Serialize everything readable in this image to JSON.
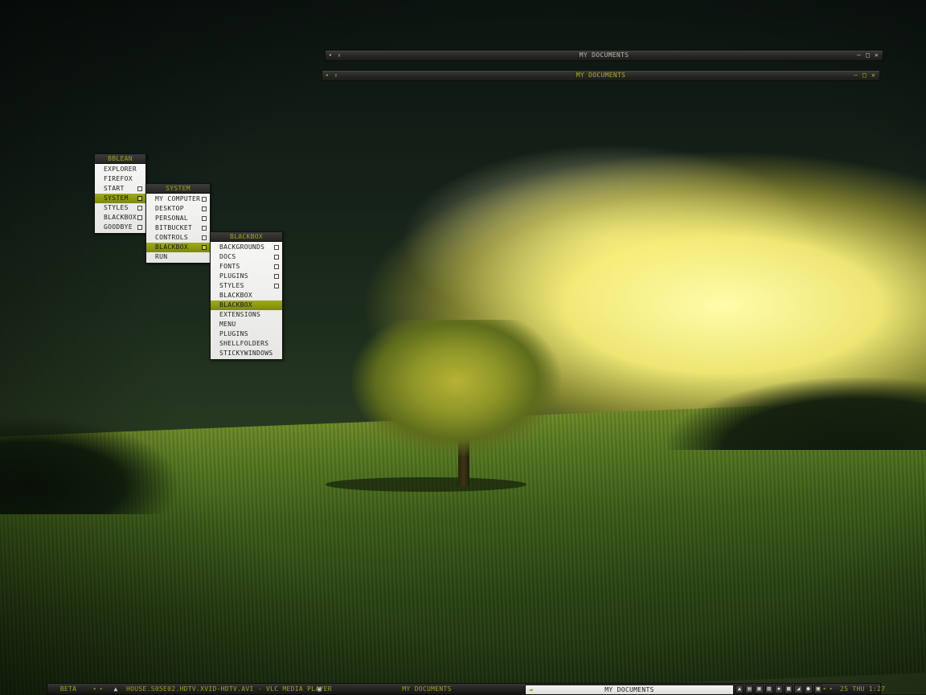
{
  "windows": [
    {
      "title": "MY DOCUMENTS",
      "left_button": "•",
      "up_icon": "↑",
      "buttons": [
        "–",
        "□",
        "✕"
      ]
    },
    {
      "title": "MY DOCUMENTS",
      "left_button": "•",
      "up_icon": "↑",
      "buttons": [
        "–",
        "□",
        "✕"
      ]
    }
  ],
  "menus": {
    "bblean": {
      "title": "BBLEAN",
      "items": [
        {
          "label": "EXPLORER"
        },
        {
          "label": "FIREFOX"
        },
        {
          "label": "START"
        },
        {
          "label": "SYSTEM"
        },
        {
          "label": "STYLES"
        },
        {
          "label": "BLACKBOX"
        },
        {
          "label": "GOODBYE"
        }
      ]
    },
    "system": {
      "title": "SYSTEM",
      "items": [
        {
          "label": "MY COMPUTER"
        },
        {
          "label": "DESKTOP"
        },
        {
          "label": "PERSONAL"
        },
        {
          "label": "BITBUCKET"
        },
        {
          "label": "CONTROLS"
        },
        {
          "label": "BLACKBOX"
        },
        {
          "label": "RUN"
        }
      ]
    },
    "blackbox": {
      "title": "BLACKBOX",
      "items": [
        {
          "label": "BACKGROUNDS"
        },
        {
          "label": "DOCS"
        },
        {
          "label": "FONTS"
        },
        {
          "label": "PLUGINS"
        },
        {
          "label": "STYLES"
        },
        {
          "label": "BLACKBOX"
        },
        {
          "label": "BLACKBOX"
        },
        {
          "label": "EXTENSIONS"
        },
        {
          "label": "MENU"
        },
        {
          "label": "PLUGINS"
        },
        {
          "label": "SHELLFOLDERS"
        },
        {
          "label": "STICKYWINDOWS"
        }
      ]
    }
  },
  "taskbar": {
    "workspace": "BETA",
    "prev_arrow": "◂",
    "next_arrow": "▸",
    "tasks": [
      {
        "label": "HOUSE.S05E02.HDTV.XVID-HDTV.AVI - VLC MEDIA PLAYER",
        "icon": "▲"
      },
      {
        "label": "MY DOCUMENTS",
        "icon": "▣"
      },
      {
        "label": "MY DOCUMENTS",
        "icon": "▰"
      }
    ],
    "tray_icons": [
      "▲",
      "▤",
      "▦",
      "▧",
      "▪",
      "▩",
      "◢",
      "●",
      "▣"
    ],
    "clock": "25 THU 1:27"
  },
  "colors": {
    "accent": "#9aa41c",
    "selection": "#8c9816",
    "menu_bg": "#eeeeec",
    "bar_dark": "#262624"
  }
}
